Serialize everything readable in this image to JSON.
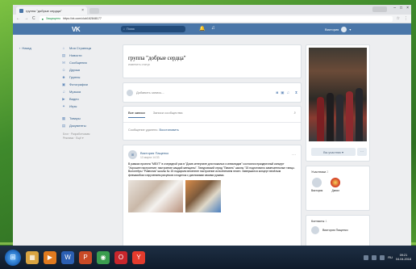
{
  "browser": {
    "tab_title": "группа \"добрые сердца\"",
    "tab_close": "×",
    "window_controls": [
      "–",
      "□",
      "×"
    ],
    "back": "←",
    "forward": "→",
    "reload": "C",
    "secure_label": "Защищено",
    "url": "https://vk.com/club162848177",
    "star": "☆",
    "menu": "⋮"
  },
  "vk_header": {
    "logo": "VK",
    "search_placeholder": "Поиск",
    "user_name": "Виктория",
    "bell_icon": "bell-icon",
    "music_icon": "music-icon"
  },
  "back_link": {
    "arrow": "‹",
    "label": "Назад"
  },
  "sidebar": {
    "items": [
      {
        "icon": "⌂",
        "label": "Моя Страница"
      },
      {
        "icon": "▤",
        "label": "Новости"
      },
      {
        "icon": "✉",
        "label": "Сообщения"
      },
      {
        "icon": "☺",
        "label": "Друзья"
      },
      {
        "icon": "☻",
        "label": "Группы"
      },
      {
        "icon": "▣",
        "label": "Фотографии"
      },
      {
        "icon": "♫",
        "label": "Музыка"
      },
      {
        "icon": "▶",
        "label": "Видео"
      },
      {
        "icon": "✦",
        "label": "Игры"
      }
    ],
    "items2": [
      {
        "icon": "▦",
        "label": "Товары"
      },
      {
        "icon": "▤",
        "label": "Документы"
      }
    ],
    "footer_line1": "Блог · Разработчикам",
    "footer_line2": "Реклама · Ещё ▾"
  },
  "group": {
    "title": "группа \"добрые сердца\"",
    "status": "изменить статус"
  },
  "composer": {
    "placeholder": "Добавить запись...",
    "tools": [
      "◙",
      "▣",
      "♫"
    ],
    "timer": "⧗"
  },
  "wall": {
    "tab_all": "Все записи",
    "tab_community": "Записи сообщества",
    "search_icon": "⌕",
    "deleted_text": "Сообщение удалено.",
    "restore": "Восстановить"
  },
  "post": {
    "author": "Виктория Пащенко",
    "date": "13 марта 14:33",
    "more": "···",
    "text": "В рамках проекта \"МЕХТ\" в очередной раз в \"Доме-интернате для пожилых и инвалидов\" состоялся праздничный концерт \"Хорошее настроение: настроение каждой женщины\". Тимуровский отряд \"Память\" школы \"15 подготовило замечательные танцы. Волонтёры \"Ровесник\" школы № 15 подарили весеннее настроение исполнением песен. Завершился концерт весёлым флешмобом и вручением рисунков и поделок с дипломами своими руками."
  },
  "right": {
    "member_button": "Вы участник ▾",
    "more_button": "···",
    "members_label": "Участники",
    "members_count": "2",
    "members": [
      {
        "name": "Виктория"
      },
      {
        "name": "Данил"
      }
    ],
    "contacts_label": "Контакты",
    "contacts_count": "1",
    "contact_name": "Виктория Пащенко"
  },
  "taskbar": {
    "start_icon": "⊞",
    "apps": [
      {
        "name": "explorer-icon",
        "glyph": "▦",
        "color": "#d9a441"
      },
      {
        "name": "media-icon",
        "glyph": "▶",
        "color": "#e07a1f"
      },
      {
        "name": "word-icon",
        "glyph": "W",
        "color": "#2b5fb3"
      },
      {
        "name": "powerpoint-icon",
        "glyph": "P",
        "color": "#c94a26"
      },
      {
        "name": "chrome-icon",
        "glyph": "◉",
        "color": "#3a9d4f"
      },
      {
        "name": "opera-icon",
        "glyph": "O",
        "color": "#c8262c"
      },
      {
        "name": "yandex-icon",
        "glyph": "Y",
        "color": "#e33b2d"
      }
    ],
    "lang": "RU",
    "time": "09:21",
    "date": "04.04.2018"
  }
}
